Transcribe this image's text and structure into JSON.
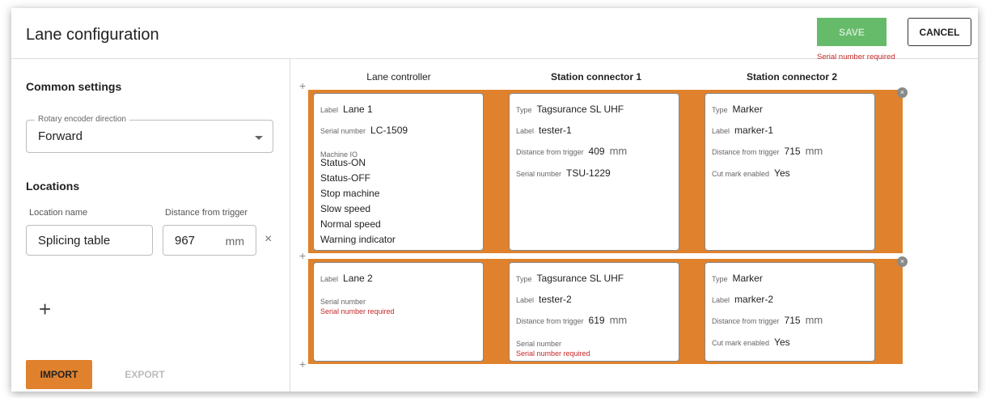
{
  "dialog": {
    "title": "Lane configuration",
    "save_label": "SAVE",
    "save_error": "Serial number required",
    "cancel_label": "CANCEL"
  },
  "common_settings": {
    "title": "Common settings",
    "encoder_label": "Rotary encoder direction",
    "encoder_value": "Forward"
  },
  "locations": {
    "title": "Locations",
    "col_name": "Location name",
    "col_distance": "Distance from trigger",
    "items": [
      {
        "name": "Splicing table",
        "distance": "967",
        "unit": "mm"
      }
    ],
    "clear_icon": "×",
    "add_icon": "+"
  },
  "footer": {
    "import_label": "IMPORT",
    "export_label": "EXPORT"
  },
  "columns": [
    "Lane controller",
    "Station connector 1",
    "Station connector 2"
  ],
  "icons": {
    "plus": "+",
    "remove": "×"
  },
  "lanes": [
    {
      "controller": {
        "label_caption": "Label",
        "label": "Lane 1",
        "serial_caption": "Serial number",
        "serial": "LC-1509",
        "io_caption": "Machine IO",
        "io": [
          "Status-ON",
          "Status-OFF",
          "Stop machine",
          "Slow speed",
          "Normal speed",
          "Warning indicator"
        ]
      },
      "station1": {
        "type_caption": "Type",
        "type": "Tagsurance SL UHF",
        "label_caption": "Label",
        "label": "tester-1",
        "distance_caption": "Distance from trigger",
        "distance": "409",
        "unit": "mm",
        "serial_caption": "Serial number",
        "serial": "TSU-1229"
      },
      "station2": {
        "type_caption": "Type",
        "type": "Marker",
        "label_caption": "Label",
        "label": "marker-1",
        "distance_caption": "Distance from trigger",
        "distance": "715",
        "unit": "mm",
        "cut_caption": "Cut mark enabled",
        "cut": "Yes"
      }
    },
    {
      "controller": {
        "label_caption": "Label",
        "label": "Lane 2",
        "serial_caption": "Serial number",
        "serial_error": "Serial number required"
      },
      "station1": {
        "type_caption": "Type",
        "type": "Tagsurance SL UHF",
        "label_caption": "Label",
        "label": "tester-2",
        "distance_caption": "Distance from trigger",
        "distance": "619",
        "unit": "mm",
        "serial_caption": "Serial number",
        "serial_error": "Serial number required"
      },
      "station2": {
        "type_caption": "Type",
        "type": "Marker",
        "label_caption": "Label",
        "label": "marker-2",
        "distance_caption": "Distance from trigger",
        "distance": "715",
        "unit": "mm",
        "cut_caption": "Cut mark enabled",
        "cut": "Yes"
      }
    }
  ],
  "colors": {
    "accent": "#e0822d",
    "save": "#66bb6a",
    "error": "#c62828"
  }
}
